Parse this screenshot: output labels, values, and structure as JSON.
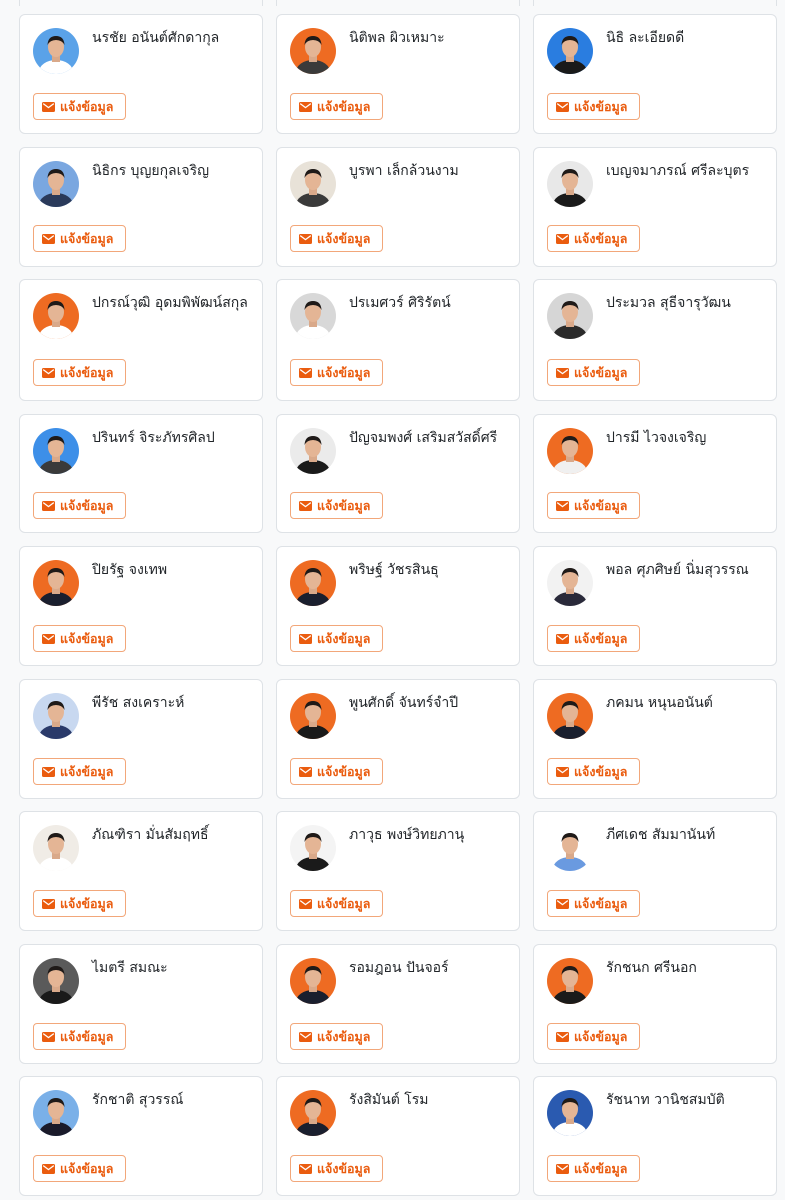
{
  "button_label": "แจ้งข้อมูล",
  "colors": {
    "accent": "#ea5c0f",
    "accent_border": "#f2a77a",
    "card_border": "#dee2e6",
    "background": "#f8f9fa"
  },
  "cards": [
    {
      "name": "นรชัย อนันต์ศักดากุล",
      "avatar_bg": "#5aa2e8",
      "shirt": "#ffffff"
    },
    {
      "name": "นิติพล ผิวเหมาะ",
      "avatar_bg": "#ee6b22",
      "shirt": "#3a3a3a"
    },
    {
      "name": "นิธิ ละเอียดดี",
      "avatar_bg": "#2a7de0",
      "shirt": "#1a1a1a"
    },
    {
      "name": "นิธิกร บุญยกุลเจริญ",
      "avatar_bg": "#7aa7e0",
      "shirt": "#2a3a5a"
    },
    {
      "name": "บูรพา เล็กล้วนงาม",
      "avatar_bg": "#e8e2d8",
      "shirt": "#3a3a3a"
    },
    {
      "name": "เบญจมาภรณ์ ศรีละบุตร",
      "avatar_bg": "#e8e8e8",
      "shirt": "#1a1a1a"
    },
    {
      "name": "ปกรณ์วุฒิ อุดมพิพัฒน์สกุล",
      "avatar_bg": "#ee6b22",
      "shirt": "#ffffff"
    },
    {
      "name": "ปรเมศวร์ ศิริรัตน์",
      "avatar_bg": "#d8d8d8",
      "shirt": "#ffffff"
    },
    {
      "name": "ประมวล สุธีจารุวัฒน",
      "avatar_bg": "#d6d6d6",
      "shirt": "#2a2a2a"
    },
    {
      "name": "ปรินทร์ จิระภัทรศิลป",
      "avatar_bg": "#3d8fe8",
      "shirt": "#3a3a3a"
    },
    {
      "name": "ปัญจมพงศ์ เสริมสวัสดิ์ศรี",
      "avatar_bg": "#ebebeb",
      "shirt": "#1a1a1a"
    },
    {
      "name": "ปารมี ไวจงเจริญ",
      "avatar_bg": "#ee6b22",
      "shirt": "#f0f0f0"
    },
    {
      "name": "ปิยรัฐ จงเทพ",
      "avatar_bg": "#ee6b22",
      "shirt": "#1a1f2e"
    },
    {
      "name": "พริษฐ์ วัชรสินธุ",
      "avatar_bg": "#ee6b22",
      "shirt": "#1a1f2e"
    },
    {
      "name": "พอล ศุภศิษย์ นิ่มสุวรรณ",
      "avatar_bg": "#f2f2f2",
      "shirt": "#2a2a3a"
    },
    {
      "name": "พีรัช สงเคราะห์",
      "avatar_bg": "#c8d8f0",
      "shirt": "#2a3a6a"
    },
    {
      "name": "พูนศักดิ์ จันทร์จำปี",
      "avatar_bg": "#ee6b22",
      "shirt": "#1a1a1a"
    },
    {
      "name": "ภคมน หนุนอนันต์",
      "avatar_bg": "#ee6b22",
      "shirt": "#1a1f2e"
    },
    {
      "name": "ภัณฑิรา มั่นสัมฤทธิ์",
      "avatar_bg": "#f0ece6",
      "shirt": "#ffffff"
    },
    {
      "name": "ภาวุธ พงษ์วิทยภานุ",
      "avatar_bg": "#f4f4f4",
      "shirt": "#1a1a1a"
    },
    {
      "name": "ภีศเดช สัมมานันท์",
      "avatar_bg": "#ffffff",
      "shirt": "#6a9ae0"
    },
    {
      "name": "ไมตรี สมณะ",
      "avatar_bg": "#5a5a5a",
      "shirt": "#1a1a1a"
    },
    {
      "name": "รอมฎอน ปันจอร์",
      "avatar_bg": "#ee6b22",
      "shirt": "#1a1f2e"
    },
    {
      "name": "รักชนก ศรีนอก",
      "avatar_bg": "#ee6b22",
      "shirt": "#1a1a1a"
    },
    {
      "name": "รักชาติ สุวรรณ์",
      "avatar_bg": "#7ab0e8",
      "shirt": "#1a1a2a"
    },
    {
      "name": "รังสิมันต์ โรม",
      "avatar_bg": "#ee6b22",
      "shirt": "#1a1f2e"
    },
    {
      "name": "รัชนาท วานิชสมบัติ",
      "avatar_bg": "#2a5ab0",
      "shirt": "#ffffff"
    }
  ]
}
